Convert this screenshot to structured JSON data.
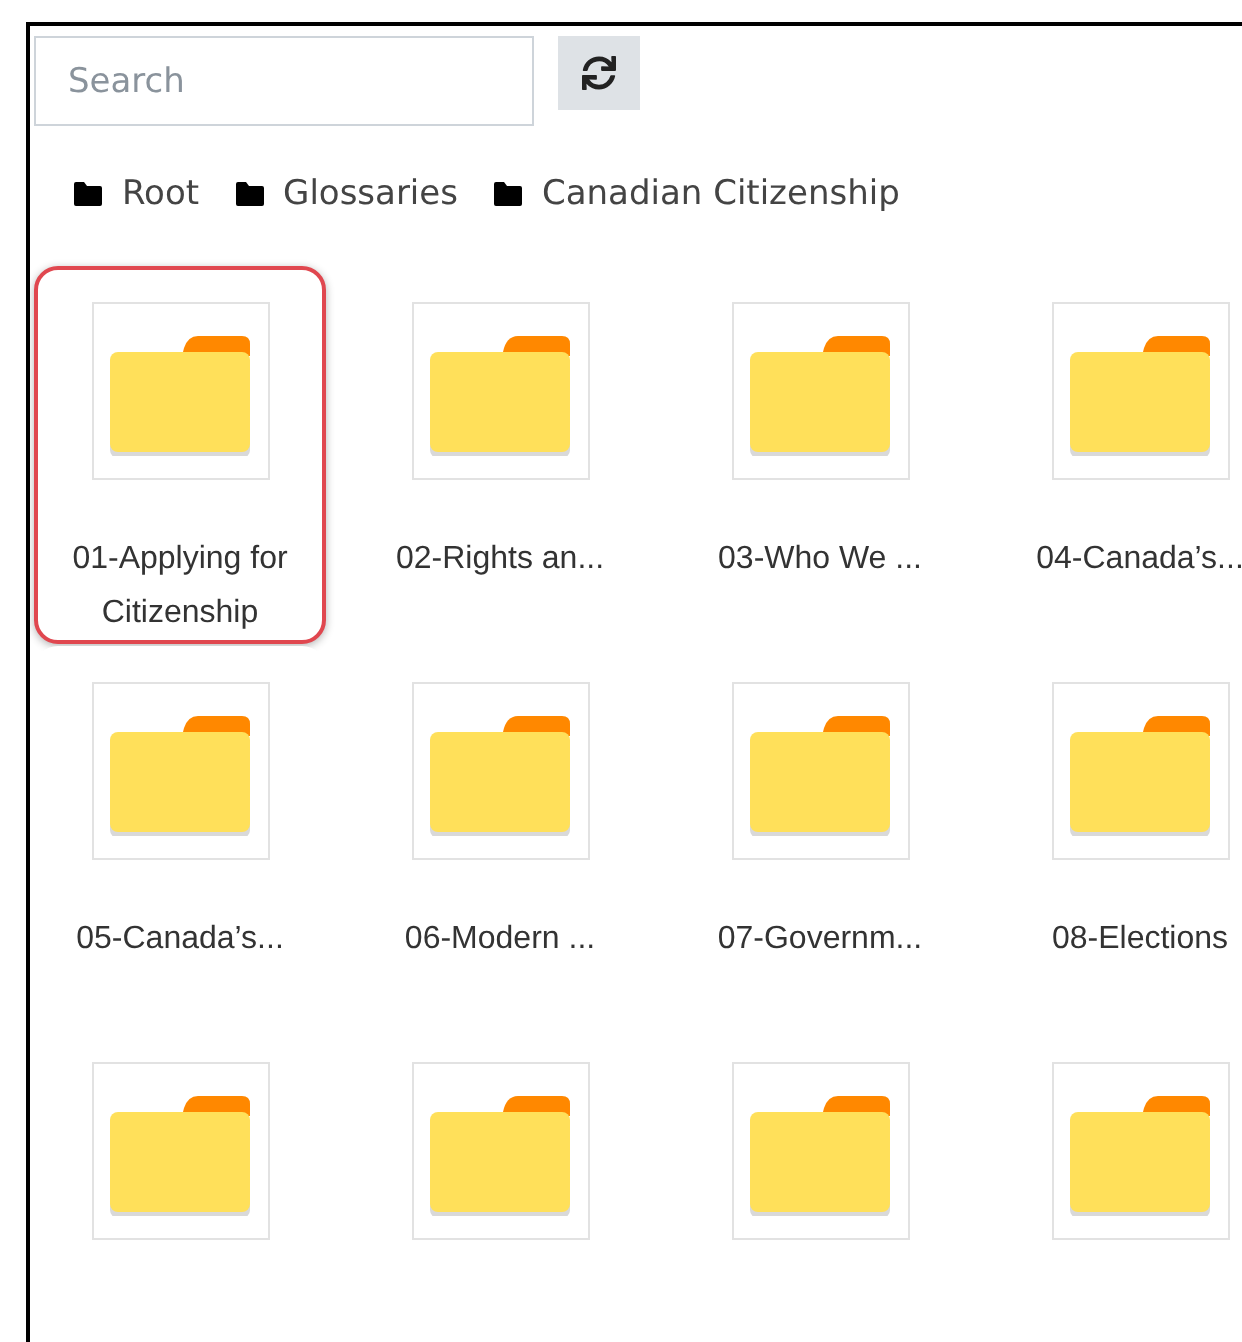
{
  "search": {
    "placeholder": "Search"
  },
  "breadcrumb": [
    "Root",
    "Glossaries",
    "Canadian Citizenship"
  ],
  "folders": [
    {
      "label": "01-Applying for Citizenship",
      "selected": true
    },
    {
      "label": "02-Rights an...",
      "selected": false
    },
    {
      "label": "03-Who We ...",
      "selected": false
    },
    {
      "label": "04-Canada’s...",
      "selected": false
    },
    {
      "label": "05-Canada’s...",
      "selected": false
    },
    {
      "label": "06-Modern ...",
      "selected": false
    },
    {
      "label": "07-Governm...",
      "selected": false
    },
    {
      "label": "08-Elections",
      "selected": false
    },
    {
      "selected": false
    },
    {
      "selected": false
    },
    {
      "selected": false
    },
    {
      "selected": false
    }
  ]
}
